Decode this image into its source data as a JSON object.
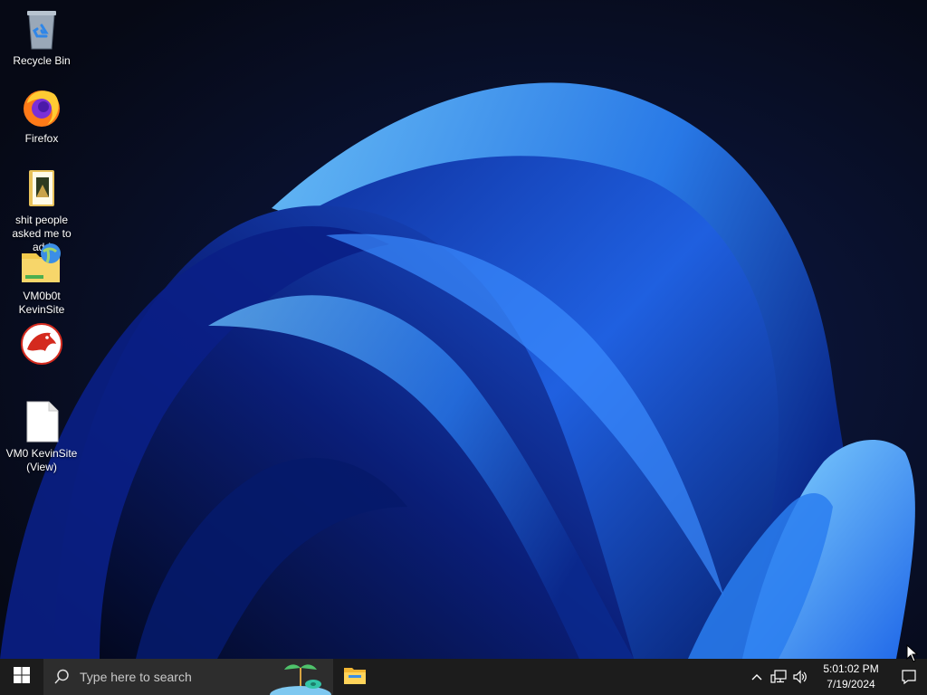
{
  "desktop": {
    "icons": [
      {
        "label": "Recycle Bin",
        "icon": "recycle-bin-icon"
      },
      {
        "label": "Firefox",
        "icon": "firefox-icon"
      },
      {
        "label": "shit people\nasked me to add",
        "icon": "folder-icon"
      },
      {
        "label": "VM0b0t\nKevinSite",
        "icon": "network-folder-icon"
      },
      {
        "label": "",
        "icon": "red-dragon-app-icon"
      },
      {
        "label": "VM0 KevinSite\n(View)",
        "icon": "document-icon"
      }
    ]
  },
  "taskbar": {
    "start_icon": "windows-logo-icon",
    "search_placeholder": "Type here to search",
    "pinned_apps": [
      {
        "icon": "file-explorer-icon"
      }
    ],
    "tray": {
      "icons": [
        "chevron-up-icon",
        "network-icon",
        "volume-icon"
      ],
      "time": "5:01:02 PM",
      "date": "7/19/2024",
      "notification_icon": "notification-icon"
    }
  },
  "colors": {
    "wallpaper_bg": "#070b1a",
    "wallpaper_blue": "#1f5fe0",
    "wallpaper_highlight": "#6cc4ff",
    "taskbar_bg": "#1c1c1c",
    "search_bg": "#2d2d2d"
  }
}
